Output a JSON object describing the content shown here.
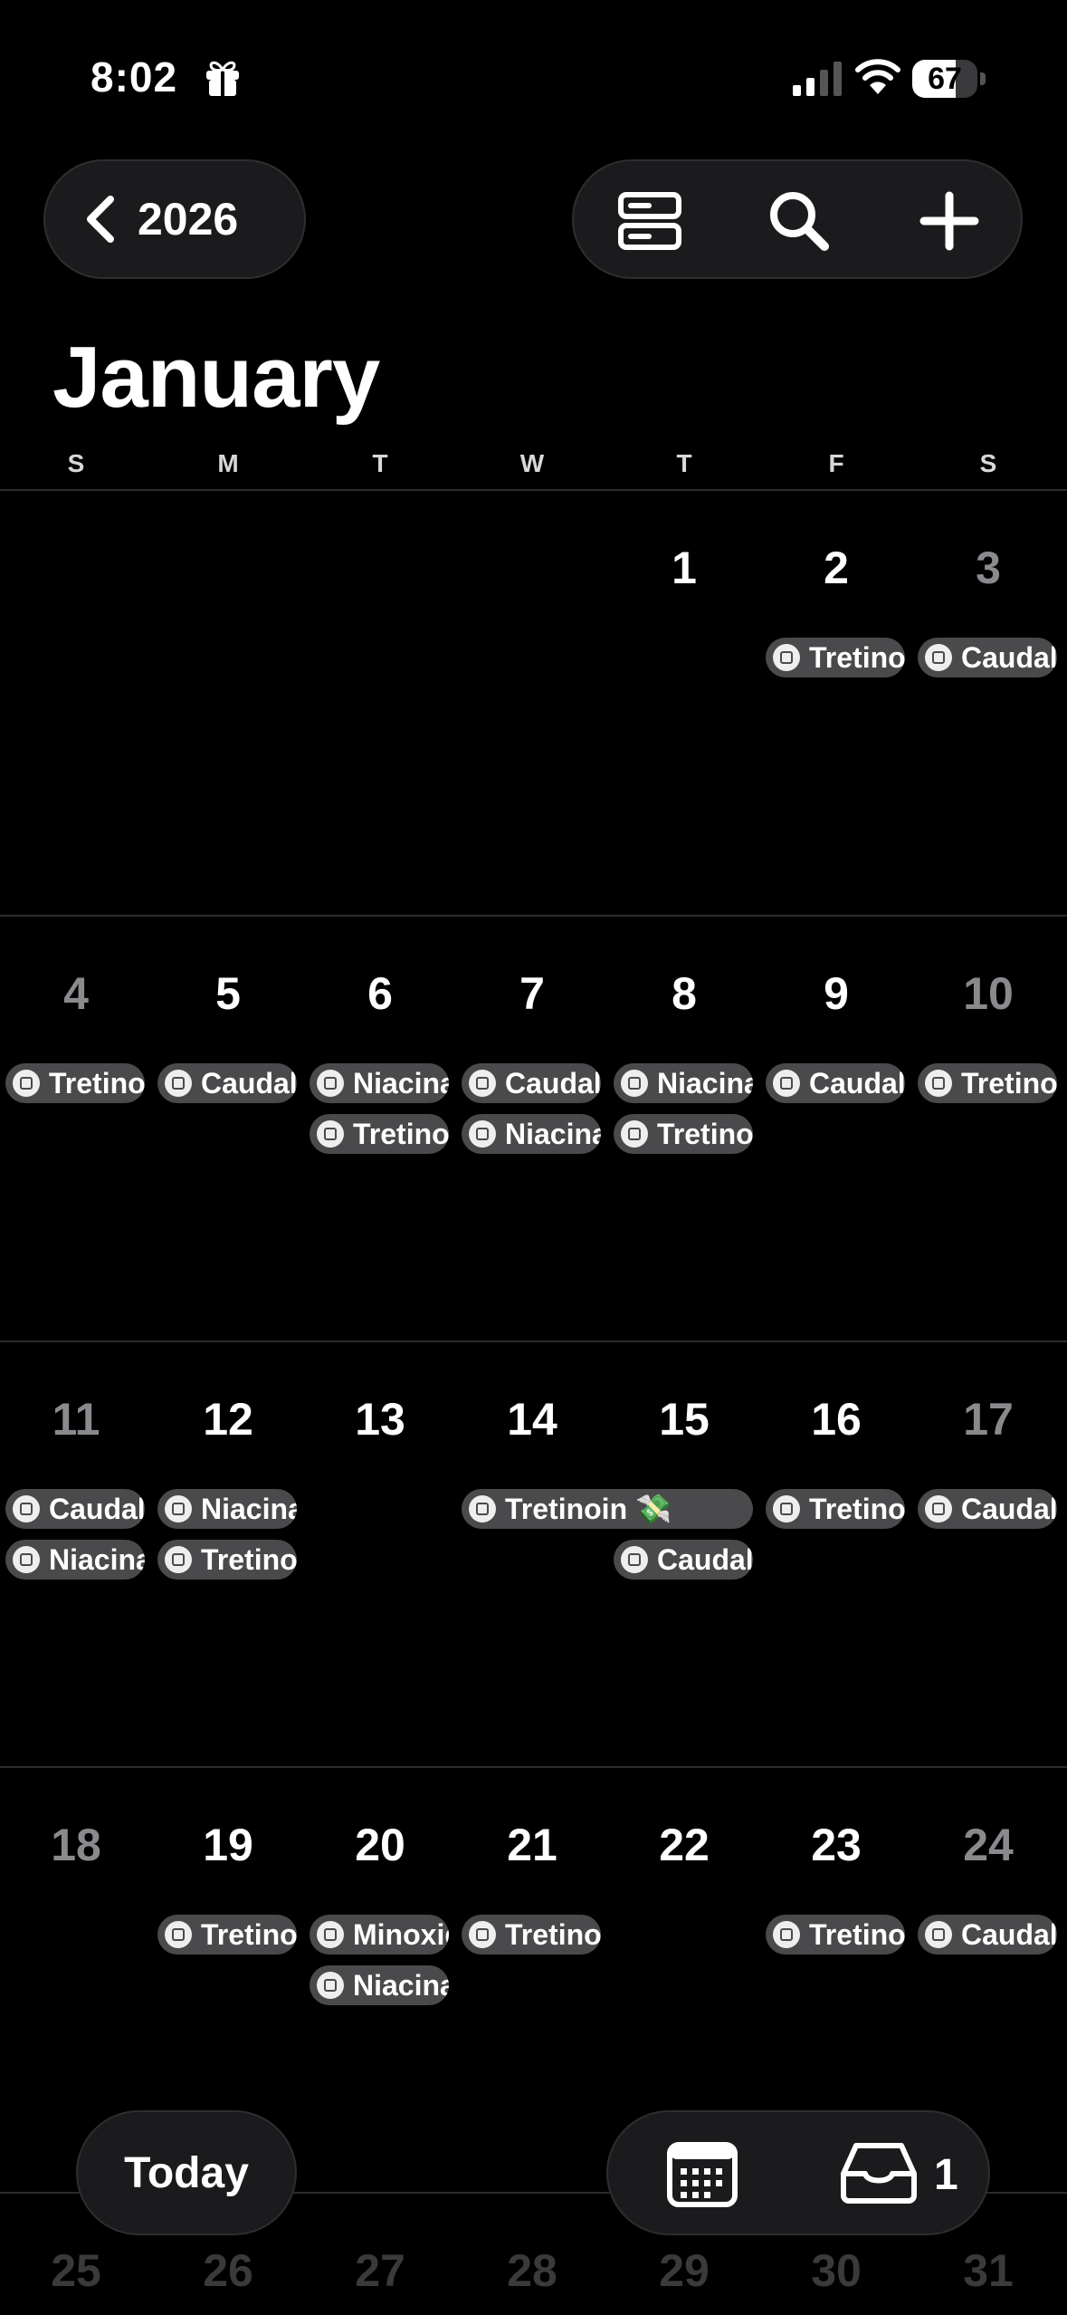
{
  "status": {
    "time": "8:02",
    "battery": "67",
    "battery_level": 0.67
  },
  "header": {
    "back_label": "2026",
    "month": "January"
  },
  "weekdays": [
    "S",
    "M",
    "T",
    "W",
    "T",
    "F",
    "S"
  ],
  "weeks": [
    {
      "days": [
        {
          "label": "",
          "weekend": true
        },
        {
          "label": ""
        },
        {
          "label": ""
        },
        {
          "label": ""
        },
        {
          "label": "1"
        },
        {
          "label": "2"
        },
        {
          "label": "3",
          "weekend": true
        }
      ],
      "events": [
        {
          "col": 5,
          "row": 0,
          "span": 1,
          "text": "Tretinoin"
        },
        {
          "col": 6,
          "row": 0,
          "span": 1,
          "text": "Caudalie"
        }
      ]
    },
    {
      "days": [
        {
          "label": "4",
          "weekend": true
        },
        {
          "label": "5"
        },
        {
          "label": "6"
        },
        {
          "label": "7"
        },
        {
          "label": "8"
        },
        {
          "label": "9"
        },
        {
          "label": "10",
          "weekend": true
        }
      ],
      "events": [
        {
          "col": 0,
          "row": 0,
          "span": 1,
          "text": "Tretinoin"
        },
        {
          "col": 1,
          "row": 0,
          "span": 1,
          "text": "Caudalie"
        },
        {
          "col": 2,
          "row": 0,
          "span": 1,
          "text": "Niacinamide"
        },
        {
          "col": 2,
          "row": 1,
          "span": 1,
          "text": "Tretinoin"
        },
        {
          "col": 3,
          "row": 0,
          "span": 1,
          "text": "Caudalie"
        },
        {
          "col": 3,
          "row": 1,
          "span": 1,
          "text": "Niacinamide"
        },
        {
          "col": 4,
          "row": 0,
          "span": 1,
          "text": "Niacinamide"
        },
        {
          "col": 4,
          "row": 1,
          "span": 1,
          "text": "Tretinoin"
        },
        {
          "col": 5,
          "row": 0,
          "span": 1,
          "text": "Caudalie"
        },
        {
          "col": 6,
          "row": 0,
          "span": 1,
          "text": "Tretinoin"
        }
      ]
    },
    {
      "days": [
        {
          "label": "11",
          "weekend": true
        },
        {
          "label": "12"
        },
        {
          "label": "13"
        },
        {
          "label": "14"
        },
        {
          "label": "15"
        },
        {
          "label": "16"
        },
        {
          "label": "17",
          "weekend": true
        }
      ],
      "events": [
        {
          "col": 0,
          "row": 0,
          "span": 1,
          "text": "Caudalie"
        },
        {
          "col": 0,
          "row": 1,
          "span": 1,
          "text": "Niacinamide"
        },
        {
          "col": 1,
          "row": 0,
          "span": 1,
          "text": "Niacinamide"
        },
        {
          "col": 1,
          "row": 1,
          "span": 1,
          "text": "Tretinoin"
        },
        {
          "col": 3,
          "row": 0,
          "span": 2,
          "text": "Tretinoin 💸"
        },
        {
          "col": 4,
          "row": 1,
          "span": 1,
          "text": "Caudalie"
        },
        {
          "col": 5,
          "row": 0,
          "span": 1,
          "text": "Tretinoin"
        },
        {
          "col": 6,
          "row": 0,
          "span": 1,
          "text": "Caudalie"
        }
      ]
    },
    {
      "days": [
        {
          "label": "18",
          "weekend": true
        },
        {
          "label": "19"
        },
        {
          "label": "20"
        },
        {
          "label": "21"
        },
        {
          "label": "22"
        },
        {
          "label": "23"
        },
        {
          "label": "24",
          "weekend": true
        }
      ],
      "events": [
        {
          "col": 1,
          "row": 0,
          "span": 1,
          "text": "Tretinoin"
        },
        {
          "col": 2,
          "row": 0,
          "span": 1,
          "text": "Minoxidil"
        },
        {
          "col": 2,
          "row": 1,
          "span": 1,
          "text": "Niacinamide"
        },
        {
          "col": 3,
          "row": 0,
          "span": 1,
          "text": "Tretinoin"
        },
        {
          "col": 5,
          "row": 0,
          "span": 1,
          "text": "Tretinoin"
        },
        {
          "col": 6,
          "row": 0,
          "span": 1,
          "text": "Caudalie"
        }
      ]
    },
    {
      "faded": true,
      "days": [
        {
          "label": "25",
          "weekend": true
        },
        {
          "label": "26"
        },
        {
          "label": "27"
        },
        {
          "label": "28"
        },
        {
          "label": "29"
        },
        {
          "label": "30"
        },
        {
          "label": "31",
          "weekend": true
        }
      ],
      "events": []
    }
  ],
  "bottom": {
    "today_label": "Today",
    "inbox_count": "1"
  }
}
